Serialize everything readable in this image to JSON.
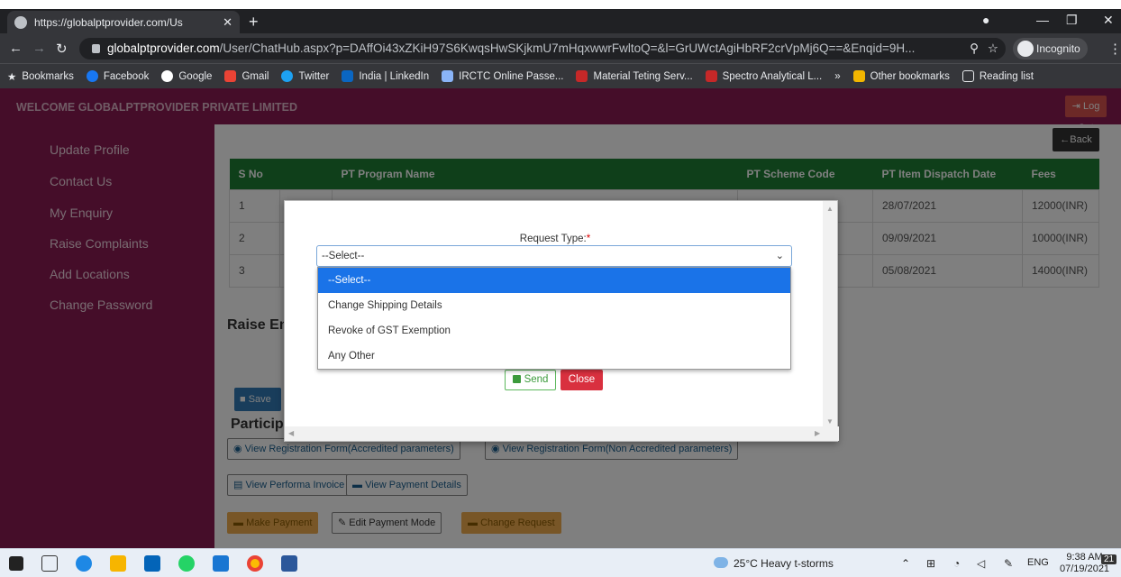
{
  "browser": {
    "tab_title": "https://globalptprovider.com/Us",
    "url_host": "globalptprovider.com",
    "url_path": "/User/ChatHub.aspx?p=DAffOi43xZKiH97S6KwqsHwSKjkmU7mHqxwwrFwltoQ=&l=GrUWctAgiHbRF2crVpMj6Q==&Enqid=9H...",
    "incognito_label": "Incognito",
    "bookmarks": [
      "Bookmarks",
      "Facebook",
      "Google",
      "Gmail",
      "Twitter",
      "India | LinkedIn",
      "IRCTC Online Passe...",
      "Material Teting Serv...",
      "Spectro Analytical L...",
      "»",
      "Other bookmarks",
      "Reading list"
    ]
  },
  "header": {
    "welcome": "WELCOME GLOBALPTPROVIDER PRIVATE LIMITED",
    "logout": "Log Out"
  },
  "sidebar": {
    "items": [
      "Update Profile",
      "Contact Us",
      "My Enquiry",
      "Raise Complaints",
      "Add Locations",
      "Change Password"
    ]
  },
  "main": {
    "back": "←Back",
    "table": {
      "headers": [
        "S No",
        "",
        "PT Program Name",
        "PT Scheme Code",
        "PT Item Dispatch Date",
        "Fees"
      ],
      "rows": [
        {
          "sno": "1",
          "date": "28/07/2021",
          "fees": "12000(INR)"
        },
        {
          "sno": "2",
          "date": "09/09/2021",
          "fees": "10000(INR)"
        },
        {
          "sno": "3",
          "date": "05/08/2021",
          "fees": "14000(INR)"
        }
      ]
    },
    "raise_heading": "Raise En",
    "save": "Save",
    "particip_heading": "Particip",
    "buttons": {
      "view_reg_acc": "View Registration Form(Accredited parameters)",
      "view_reg_nonacc": "View Registration Form(Non Accredited parameters)",
      "view_performa": "View Performa Invoice",
      "view_payment": "View Payment Details",
      "make_payment": "Make Payment",
      "edit_payment": "Edit Payment Mode",
      "change_request": "Change Request"
    }
  },
  "modal": {
    "request_label": "Request Type:",
    "required_mark": "*",
    "selected": "--Select--",
    "options": [
      "--Select--",
      "Change Shipping Details",
      "Revoke of GST Exemption",
      "Any Other"
    ],
    "send": "Send",
    "close": "Close"
  },
  "taskbar": {
    "weather": "25°C  Heavy t-storms",
    "lang": "ENG",
    "time": "9:38 AM",
    "date": "07/19/2021",
    "notif_count": "21"
  }
}
